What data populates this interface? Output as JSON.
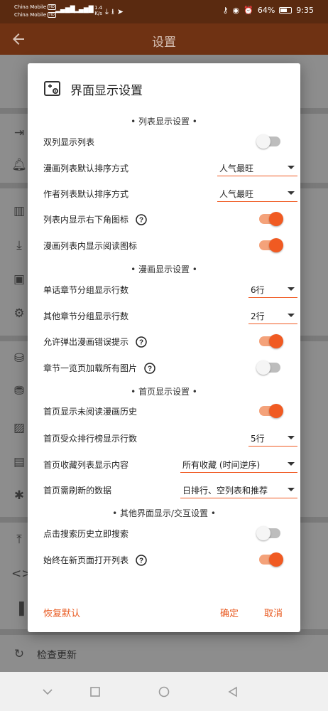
{
  "status_bar": {
    "carrier1": "China Mobile",
    "carrier2": "China Mobile",
    "hd": "HD",
    "net1": "4G",
    "net2": "4G",
    "speed_value": "1.4",
    "speed_unit": "K/s",
    "battery": "64%",
    "battery_level": 0.64,
    "time": "9:35"
  },
  "app_bar": {
    "title": "设置"
  },
  "background": {
    "visible_item_label": "检查更新"
  },
  "dialog": {
    "title": "界面显示设置",
    "sections": [
      {
        "header": "• 列表显示设置 •"
      },
      {
        "header": "• 漫画显示设置 •"
      },
      {
        "header": "• 首页显示设置 •"
      },
      {
        "header": "• 其他界面显示/交互设置 •"
      }
    ],
    "rows": [
      {
        "label": "双列显示列表",
        "type": "toggle",
        "on": false
      },
      {
        "label": "漫画列表默认排序方式",
        "type": "select",
        "value": "人气最旺"
      },
      {
        "label": "作者列表默认排序方式",
        "type": "select",
        "value": "人气最旺"
      },
      {
        "label": "列表内显示右下角图标",
        "type": "toggle",
        "on": true,
        "help": true
      },
      {
        "label": "漫画列表内显示阅读图标",
        "type": "toggle",
        "on": true
      },
      {
        "label": "单话章节分组显示行数",
        "type": "select",
        "value": "6行"
      },
      {
        "label": "其他章节分组显示行数",
        "type": "select",
        "value": "2行"
      },
      {
        "label": "允许弹出漫画错误提示",
        "type": "toggle",
        "on": true,
        "help": true
      },
      {
        "label": "章节一览页加载所有图片",
        "type": "toggle",
        "on": false,
        "help": true
      },
      {
        "label": "首页显示未阅读漫画历史",
        "type": "toggle",
        "on": true
      },
      {
        "label": "首页受众排行榜显示行数",
        "type": "select",
        "value": "5行"
      },
      {
        "label": "首页收藏列表显示内容",
        "type": "select",
        "value": "所有收藏 (时间逆序)"
      },
      {
        "label": "首页需刷新的数据",
        "type": "select",
        "value": "日排行、空列表和推荐"
      },
      {
        "label": "点击搜索历史立即搜索",
        "type": "toggle",
        "on": false
      },
      {
        "label": "始终在新页面打开列表",
        "type": "toggle",
        "on": true,
        "help": true
      }
    ],
    "buttons": {
      "reset": "恢复默认",
      "confirm": "确定",
      "cancel": "取消"
    }
  },
  "colors": {
    "accent": "#f05a22",
    "accent_track": "#f4a27a",
    "appbar": "#6f3213",
    "statusbar": "#5a2a10"
  }
}
